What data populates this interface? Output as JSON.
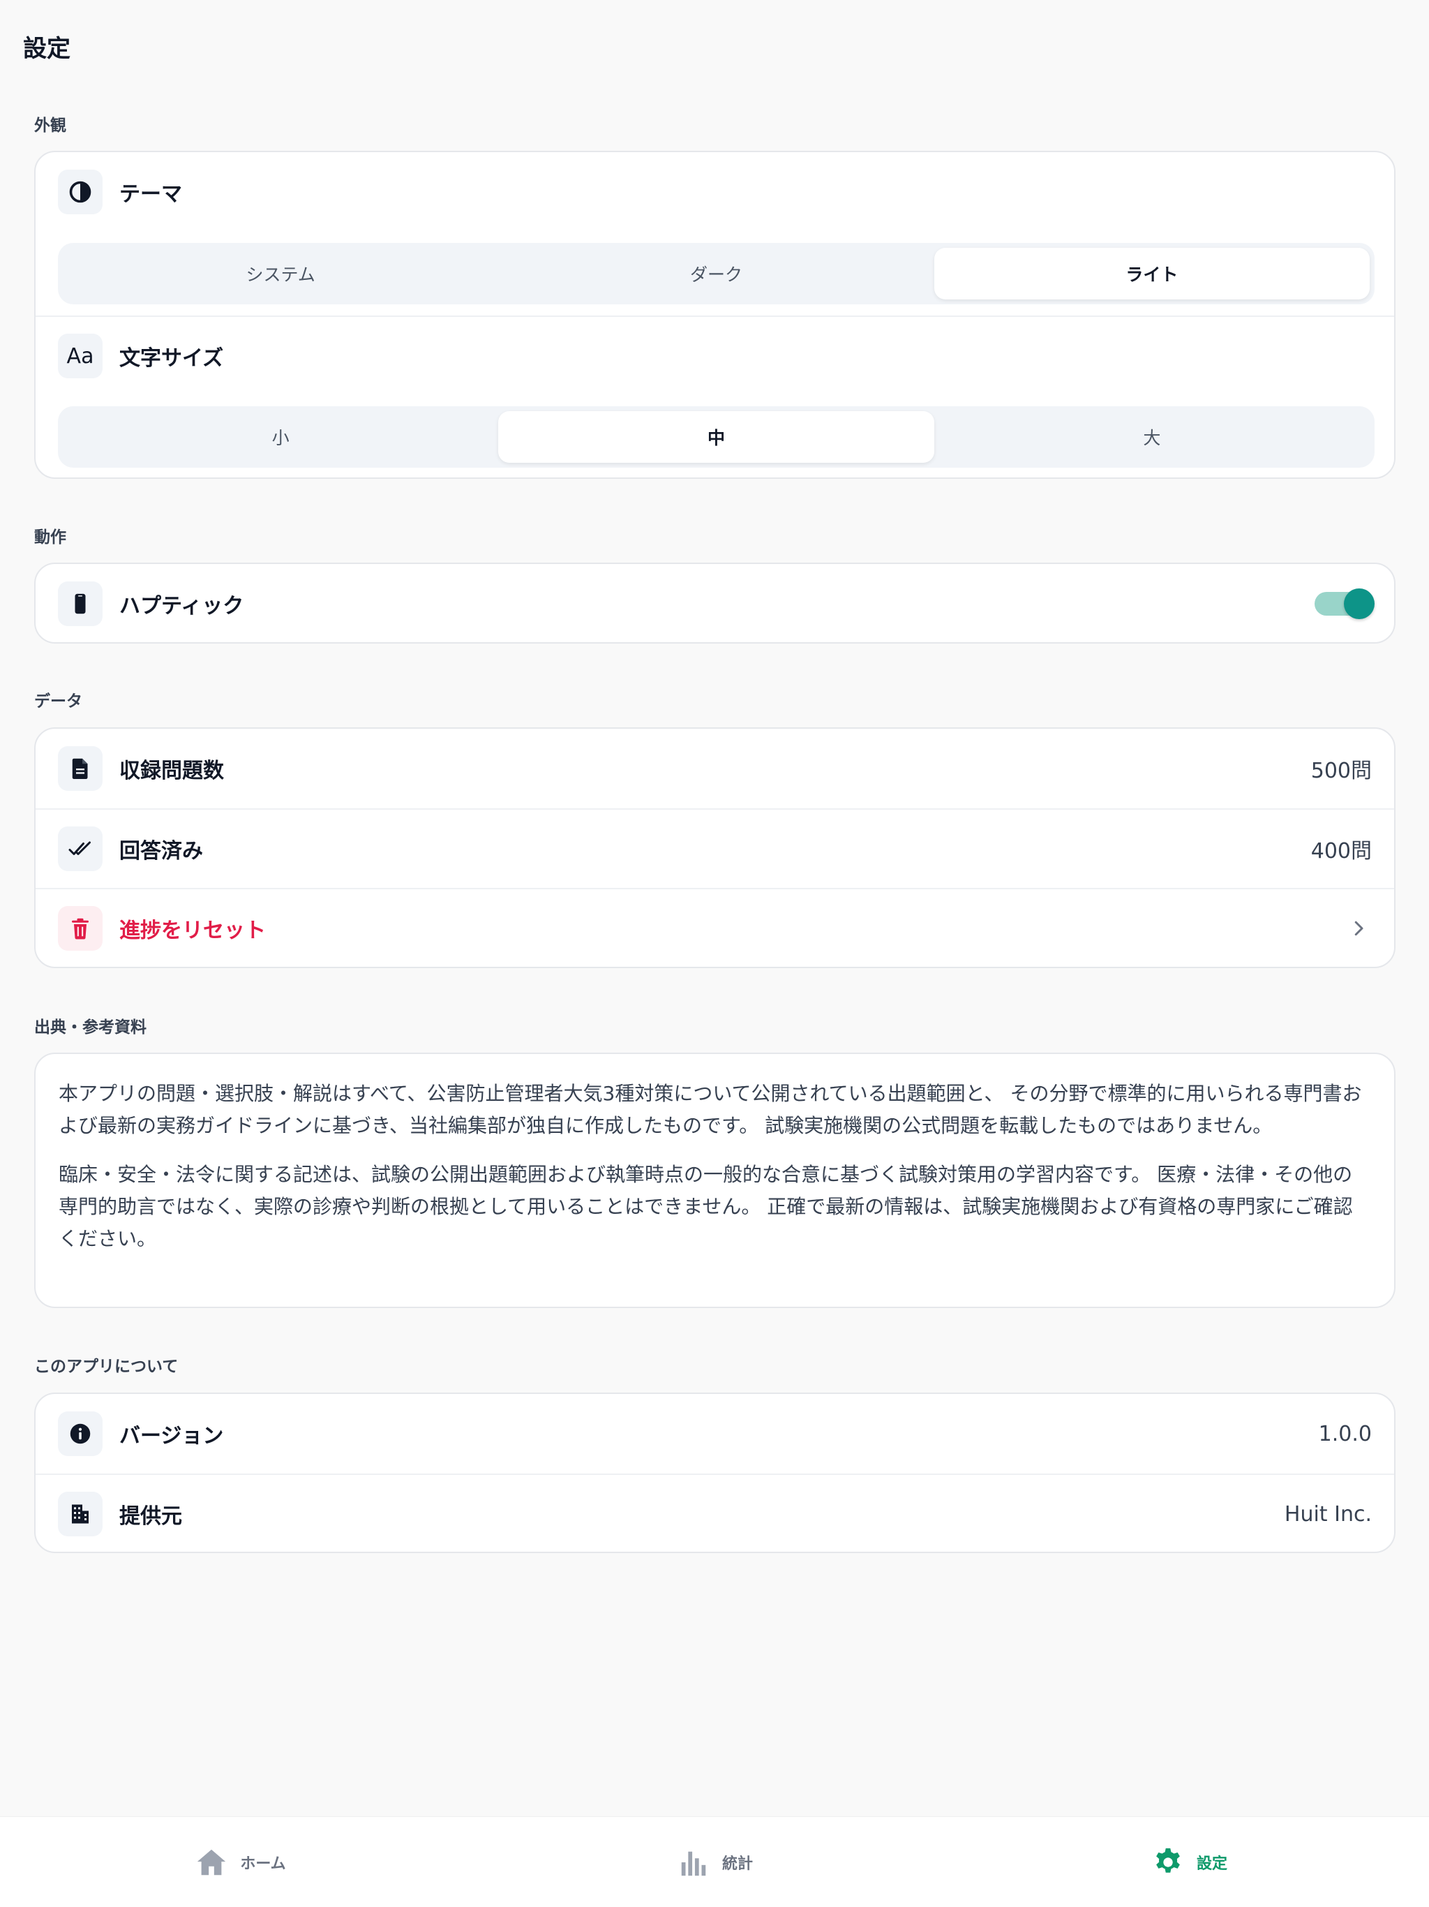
{
  "header": {
    "title": "設定"
  },
  "appearance": {
    "section_label": "外観",
    "theme": {
      "label": "テーマ",
      "icon": "contrast-icon",
      "options": [
        "システム",
        "ダーク",
        "ライト"
      ],
      "selected": "ライト"
    },
    "font_size": {
      "label": "文字サイズ",
      "icon": "text-size-icon",
      "icon_text": "Aa",
      "options": [
        "小",
        "中",
        "大"
      ],
      "selected": "中"
    }
  },
  "behavior": {
    "section_label": "動作",
    "haptic": {
      "label": "ハプティック",
      "icon": "phone-icon",
      "enabled": true
    }
  },
  "data": {
    "section_label": "データ",
    "total_questions": {
      "label": "収録問題数",
      "value": "500問",
      "icon": "document-icon"
    },
    "answered": {
      "label": "回答済み",
      "value": "400問",
      "icon": "double-check-icon"
    },
    "reset": {
      "label": "進捗をリセット",
      "icon": "trash-icon"
    }
  },
  "sources": {
    "section_label": "出典・参考資料",
    "paragraph1": "本アプリの問題・選択肢・解説はすべて、公害防止管理者大気3種対策について公開されている出題範囲と、 その分野で標準的に用いられる専門書および最新の実務ガイドラインに基づき、当社編集部が独自に作成したものです。 試験実施機関の公式問題を転載したものではありません。",
    "paragraph2": "臨床・安全・法令に関する記述は、試験の公開出題範囲および執筆時点の一般的な合意に基づく試験対策用の学習内容です。 医療・法律・その他の専門的助言ではなく、実際の診療や判断の根拠として用いることはできません。 正確で最新の情報は、試験実施機関および有資格の専門家にご確認ください。"
  },
  "about": {
    "section_label": "このアプリについて",
    "version": {
      "label": "バージョン",
      "value": "1.0.0",
      "icon": "info-icon"
    },
    "provider": {
      "label": "提供元",
      "value": "Huit Inc.",
      "icon": "building-icon"
    }
  },
  "tabbar": {
    "tabs": [
      {
        "label": "ホーム",
        "icon": "home-icon",
        "active": false
      },
      {
        "label": "統計",
        "icon": "chart-icon",
        "active": false
      },
      {
        "label": "設定",
        "icon": "gear-icon",
        "active": true
      }
    ]
  },
  "colors": {
    "accent": "#0d9488",
    "active_tab": "#0f9a6b",
    "danger": "#e11d48",
    "background": "#f9f9f9"
  }
}
